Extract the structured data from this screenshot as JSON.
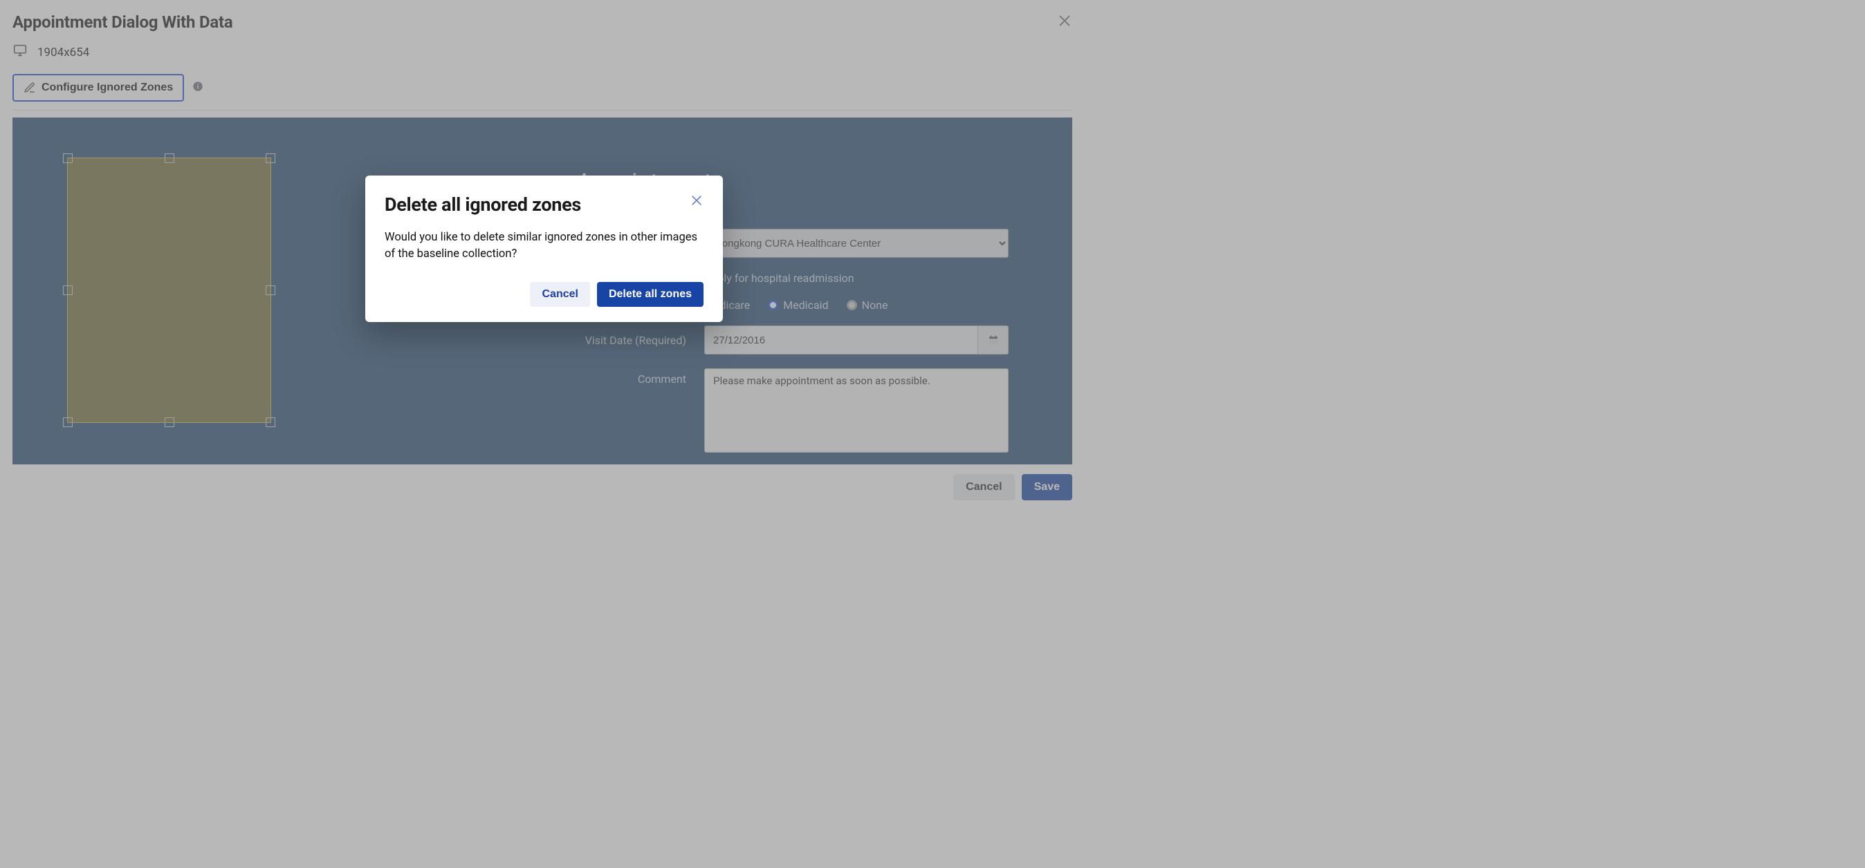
{
  "header": {
    "title": "Appointment Dialog With Data",
    "dimensions": "1904x654",
    "configure_label": "Configure Ignored Zones"
  },
  "appointment_form": {
    "title_suffix": "e Appointment",
    "facility_value": "Hongkong CURA Healthcare Center",
    "readmission_label": "Apply for hospital readmission",
    "programs": {
      "medicare": "Medicare",
      "medicaid": "Medicaid",
      "none": "None"
    },
    "visit_date_label": "Visit Date (Required)",
    "visit_date_value": "27/12/2016",
    "comment_label": "Comment",
    "comment_value": "Please make appointment as soon as possible."
  },
  "footer": {
    "cancel": "Cancel",
    "save": "Save"
  },
  "modal": {
    "title": "Delete all ignored zones",
    "body": "Would you like to delete similar ignored zones in other images of the baseline collection?",
    "cancel": "Cancel",
    "confirm": "Delete all zones"
  }
}
